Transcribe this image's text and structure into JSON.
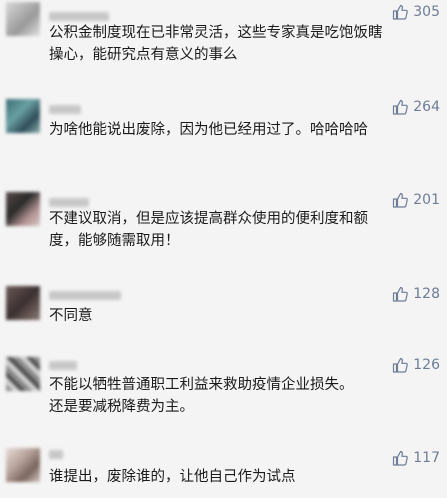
{
  "comments": [
    {
      "likes": "305",
      "lines": [
        "公积金制度现在已非常灵活，这些专家真是吃饱饭瞎",
        "操心，能研究点有意义的事么"
      ]
    },
    {
      "likes": "264",
      "lines": [
        "为啥他能说出废除，因为他已经用过了。哈哈哈哈"
      ]
    },
    {
      "likes": "201",
      "lines": [
        "不建议取消，但是应该提高群众使用的便利度和额",
        "度，能够随需取用！"
      ]
    },
    {
      "likes": "128",
      "lines": [
        "不同意"
      ]
    },
    {
      "likes": "126",
      "lines": [
        "不能以牺牲普通职工利益来救助疫情企业损失。",
        "还是要减税降费为主。"
      ]
    },
    {
      "likes": "117",
      "lines": [
        "谁提出，废除谁的，让他自己作为试点"
      ]
    }
  ],
  "colors": {
    "likes": "#6e7d96",
    "text": "#1a1a1a",
    "background": "#f4f4f4"
  }
}
